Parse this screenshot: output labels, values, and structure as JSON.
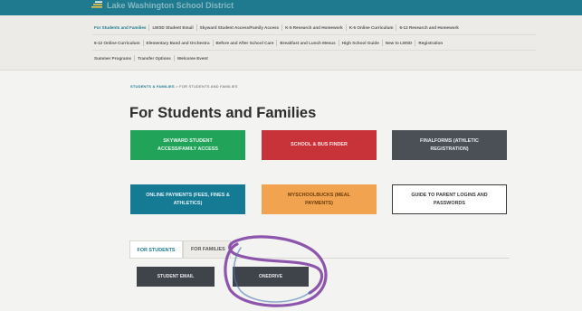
{
  "header": {
    "site_title": "Lake Washington School District"
  },
  "topnav": {
    "row1": [
      "For Students and Families",
      "LWSD Student Email",
      "Skyward Student Access/Family Access",
      "K-5 Research and Homework",
      "K-5 Online Curriculum",
      "6-12 Research and Homework"
    ],
    "row2": [
      "6-12 Online Curriculum",
      "Elementary Band and Orchestra",
      "Before and After School Care",
      "Breakfast and Lunch Menus",
      "High School Guide",
      "New to LWSD",
      "Registration"
    ],
    "row3": [
      "Summer Programs",
      "Transfer Options",
      "Welcome Event"
    ]
  },
  "breadcrumb": {
    "parent": "STUDENTS & FAMILIES",
    "separator": ">",
    "current": "FOR STUDENTS AND FAMILIES"
  },
  "page": {
    "title": "For Students and Families"
  },
  "tiles": [
    "SKYWARD STUDENT ACCESS/FAMILY ACCESS",
    "SCHOOL & BUS FINDER",
    "FINALFORMS (ATHLETIC REGISTRATION)",
    "ONLINE PAYMENTS (FEES, FINES & ATHLETICS)",
    "MYSCHOOLBUCKS (MEAL PAYMENTS)",
    "GUIDE TO PARENT LOGINS AND PASSWORDS"
  ],
  "tabs": {
    "students": "FOR STUDENTS",
    "families": "FOR FAMILIES"
  },
  "student_links": {
    "email": "STUDENT EMAIL",
    "onedrive": "ONEDRIVE"
  },
  "colors": {
    "header": "#1f7a8f",
    "tile_green": "#21a35a",
    "tile_red": "#c8333a",
    "tile_slate": "#4b4f56",
    "tile_teal": "#157a94",
    "tile_orange": "#f2a34f",
    "annotation_ink": "#7a3aa0"
  }
}
